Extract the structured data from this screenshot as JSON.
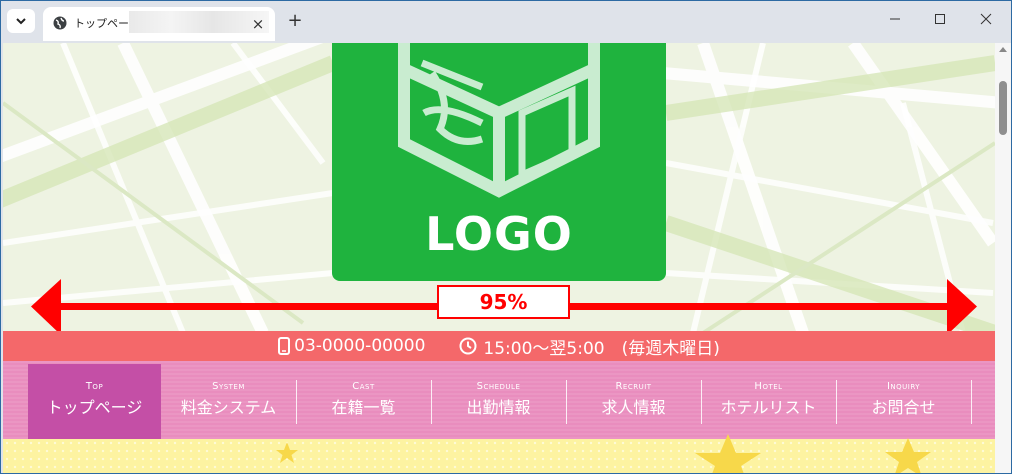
{
  "browser": {
    "tab_title": "トップページ |",
    "new_tab_label": "+",
    "tab_close_label": "×"
  },
  "logo": {
    "text": "LOGO"
  },
  "banner": {
    "width_label": "95%"
  },
  "info": {
    "phone": "03-0000-00000",
    "hours": "15:00～翌5:00　(毎週木曜日)"
  },
  "nav": {
    "items": [
      {
        "en": "Top",
        "jp": "トップページ",
        "active": true
      },
      {
        "en": "System",
        "jp": "料金システム",
        "active": false
      },
      {
        "en": "Cast",
        "jp": "在籍一覧",
        "active": false
      },
      {
        "en": "Schedule",
        "jp": "出勤情報",
        "active": false
      },
      {
        "en": "Recruit",
        "jp": "求人情報",
        "active": false
      },
      {
        "en": "Hotel",
        "jp": "ホテルリスト",
        "active": false
      },
      {
        "en": "Inquiry",
        "jp": "お問合せ",
        "active": false
      }
    ]
  },
  "colors": {
    "logo_green": "#1fb33e",
    "arrow_red": "#ff0000",
    "info_bar": "#f4686a",
    "nav_pink": "#e98dbe",
    "nav_active": "#c44fa6",
    "footer_yellow": "#fdf3a1"
  }
}
